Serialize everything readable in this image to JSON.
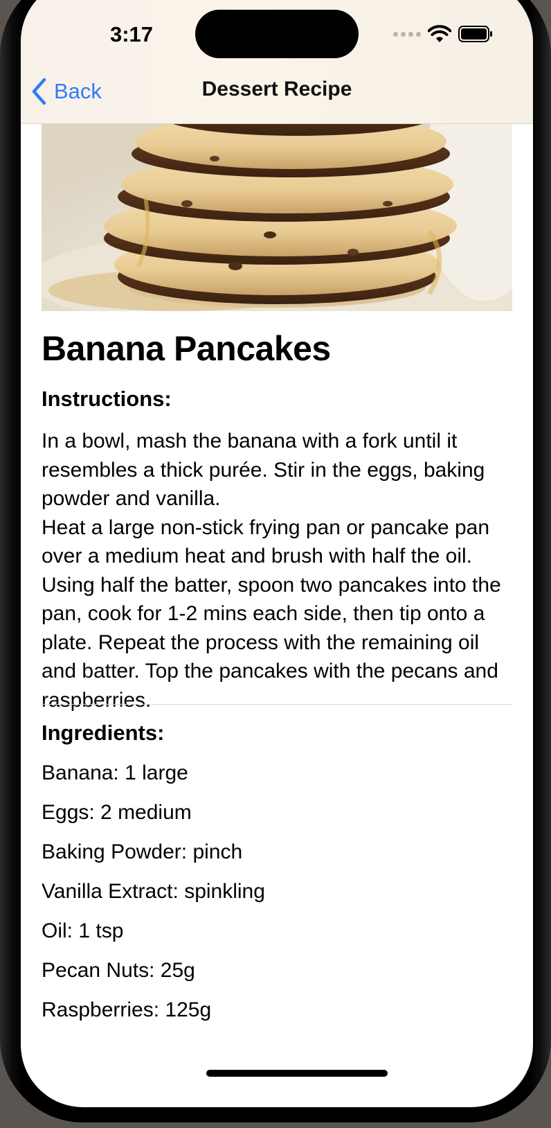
{
  "status_bar": {
    "time": "3:17"
  },
  "nav": {
    "back_label": "Back",
    "title": "Dessert Recipe"
  },
  "recipe": {
    "photo_alt": "Banana Pancakes",
    "title": "Banana Pancakes",
    "instructions_label": "Instructions:",
    "instructions": [
      "In a bowl, mash the banana with a fork until it resembles a thick purée. Stir in the eggs, baking powder and vanilla.",
      "Heat a large non-stick frying pan or pancake pan over a medium heat and brush with half the oil. Using half the batter, spoon two pancakes into the pan, cook for 1-2 mins each side, then tip onto a plate. Repeat the process with the remaining oil and batter. Top the pancakes with the pecans and raspberries."
    ],
    "ingredients_label": "Ingredients:",
    "ingredients": [
      "Banana: 1 large",
      "Eggs: 2 medium",
      "Baking Powder: pinch",
      "Vanilla Extract: spinkling",
      "Oil: 1 tsp",
      "Pecan Nuts: 25g",
      "Raspberries: 125g"
    ]
  },
  "colors": {
    "accent": "#2f7bf6",
    "header_bg": "#f8f2ea",
    "text": "#000000"
  }
}
